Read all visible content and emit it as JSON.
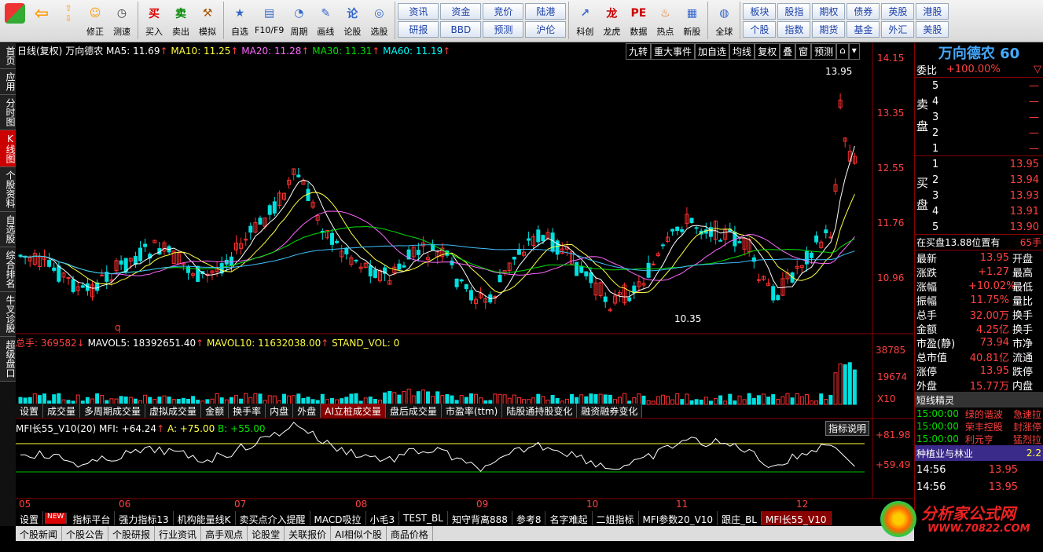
{
  "toolbar": {
    "buttons": [
      "修正",
      "测速",
      "买入",
      "卖出",
      "模拟",
      "自选",
      "F10/F9",
      "周期",
      "画线",
      "论股",
      "选股",
      "科创",
      "龙虎",
      "数据",
      "热点",
      "新股",
      "全球"
    ],
    "quick1": [
      "资讯",
      "资金",
      "竞价",
      "陆港",
      "研报",
      "BBD",
      "预测",
      "沪伦"
    ],
    "quick2": [
      "板块",
      "股指",
      "期权",
      "债券",
      "英股",
      "港股",
      "个股",
      "指数",
      "期货",
      "基金",
      "外汇",
      "美股"
    ]
  },
  "left_tabs": [
    "首页",
    "应用",
    "分时图",
    "K线图",
    "个股资料",
    "自选股",
    "综合排名",
    "牛叉诊股",
    "超级盘口"
  ],
  "header": {
    "period": "日线(复权)",
    "stock": "万向德农",
    "ma5": "MA5: 11.69",
    "ma10": "MA10: 11.25",
    "ma20": "MA20: 11.28",
    "ma30": "MA30: 11.31",
    "ma60": "MA60: 11.19"
  },
  "chart_buttons": [
    "九转",
    "重大事件",
    "加自选",
    "均线",
    "复权",
    "叠",
    "窗",
    "预测"
  ],
  "price_axis": [
    "14.15",
    "13.35",
    "12.55",
    "11.76",
    "10.96"
  ],
  "high_label": "13.95",
  "low_label": "10.35",
  "q_mark": "q",
  "vol": {
    "total": "总手: 369582",
    "mavol5": "MAVOL5: 18392651.40",
    "mavol10": "MAVOL10: 11632038.00",
    "stand": "STAND_VOL: 0",
    "axis": [
      "38785",
      "19674",
      "X10"
    ]
  },
  "tabs": [
    "设置",
    "成交量",
    "多周期成交量",
    "虚拟成交量",
    "金额",
    "换手率",
    "内盘",
    "外盘",
    "AI立桩成交量",
    "盘后成交量",
    "市盈率(ttm)",
    "陆股通持股变化",
    "融资融券变化"
  ],
  "mfi": {
    "title": "MFI长55_V10(20) MFI: +64.24",
    "a": "A: +75.00",
    "b": "B: +55.00",
    "explain": "指标说明",
    "axis": [
      "+81.98",
      "+59.49"
    ]
  },
  "months": [
    "05",
    "06",
    "07",
    "08",
    "09",
    "10",
    "11",
    "12"
  ],
  "bottom_tabs": [
    "设置",
    "NEW",
    "指标平台",
    "强力指标13",
    "机构能量线K",
    "卖买点介入提醒",
    "MACD吸拉",
    "小毛3",
    "TEST_BL",
    "知守背离888",
    "参考8",
    "名字难起",
    "二姐指标",
    "MFI参数20_V10",
    "跟庄_BL",
    "MFI长55_V10"
  ],
  "news_tabs": [
    "个股新闻",
    "个股公告",
    "个股研报",
    "行业资讯",
    "高手观点",
    "论股堂",
    "关联报价",
    "AI相似个股",
    "商品价格"
  ],
  "right": {
    "name": "万向德农 60",
    "weibi": "委比",
    "weibi_val": "+100.00%",
    "sell": [
      {
        "n": "5",
        "p": "—"
      },
      {
        "n": "4",
        "p": "—"
      },
      {
        "n": "3",
        "p": "—"
      },
      {
        "n": "2",
        "p": "—"
      },
      {
        "n": "1",
        "p": "—"
      }
    ],
    "buy": [
      {
        "n": "1",
        "p": "13.95"
      },
      {
        "n": "2",
        "p": "13.94"
      },
      {
        "n": "3",
        "p": "13.93"
      },
      {
        "n": "4",
        "p": "13.91"
      },
      {
        "n": "5",
        "p": "13.90"
      }
    ],
    "zaimai": "在买盘13.88位置有",
    "zaimai_v": "65手",
    "stats": [
      [
        "最新",
        "13.95",
        "开盘"
      ],
      [
        "涨跌",
        "+1.27",
        "最高"
      ],
      [
        "涨幅",
        "+10.02%",
        "最低"
      ],
      [
        "振幅",
        "11.75%",
        "量比"
      ],
      [
        "总手",
        "32.00万",
        "换手"
      ],
      [
        "金额",
        "4.25亿",
        "换手"
      ],
      [
        "市盈(静)",
        "73.94",
        "市净"
      ],
      [
        "总市值",
        "40.81亿",
        "流通"
      ],
      [
        "涨停",
        "13.95",
        "跌停"
      ],
      [
        "外盘",
        "15.77万",
        "内盘"
      ]
    ],
    "dxjl": "短线精灵",
    "events": [
      [
        "15:00:00",
        "绿的谐波",
        "急速拉"
      ],
      [
        "15:00:00",
        "荣丰控股",
        "封涨停"
      ],
      [
        "15:00:00",
        "利元亨",
        "猛烈拉"
      ]
    ],
    "sector": "种植业与林业",
    "sector_v": "2.2",
    "ticks": [
      [
        "14:56",
        "13.95"
      ],
      [
        "14:56",
        "13.95"
      ]
    ]
  },
  "logo": {
    "name": "分析家公式网",
    "url": "WWW.70822.COM"
  }
}
